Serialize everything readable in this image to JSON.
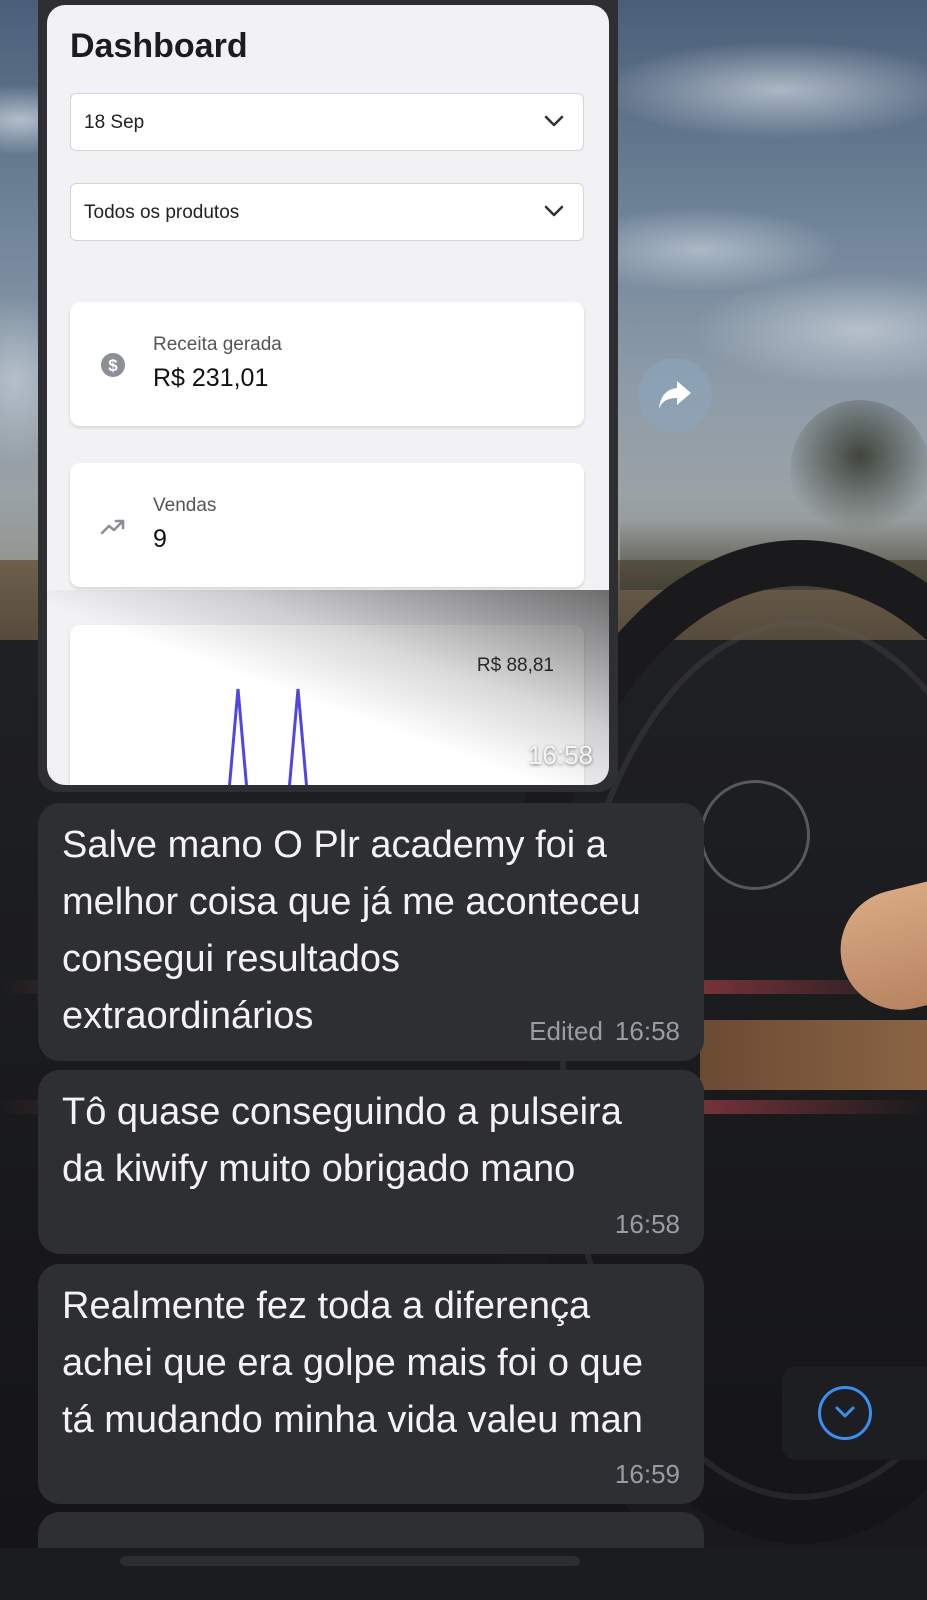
{
  "dashboard": {
    "title": "Dashboard",
    "date_select": "18 Sep",
    "product_select": "Todos os produtos",
    "revenue": {
      "label": "Receita gerada",
      "value": "R$ 231,01",
      "icon": "dollar-circle-icon"
    },
    "sales": {
      "label": "Vendas",
      "value": "9",
      "icon": "trending-up-icon"
    },
    "chart": {
      "max_label": "R$ 88,81",
      "line_color": "#4f46e5"
    },
    "timestamp": "16:58"
  },
  "messages": [
    {
      "text": "Salve mano O Plr academy foi a\nmelhor coisa que já me aconteceu\nconsegui resultados\nextraordinários",
      "edited": "Edited",
      "time": "16:58"
    },
    {
      "text": "Tô quase conseguindo a pulseira\nda kiwify muito obrigado mano",
      "time": "16:58"
    },
    {
      "text": "Realmente fez toda a diferença\nachei que era golpe mais foi o que\ntá mudando minha vida valeu man",
      "time": "16:59"
    }
  ],
  "icons": {
    "share": "share-forward-icon",
    "scroll_down": "chevron-down-circle-icon"
  },
  "colors": {
    "bubble": "#2e2f33",
    "accent_blue": "#3d8ef0",
    "chart_line": "#4f46e5"
  }
}
